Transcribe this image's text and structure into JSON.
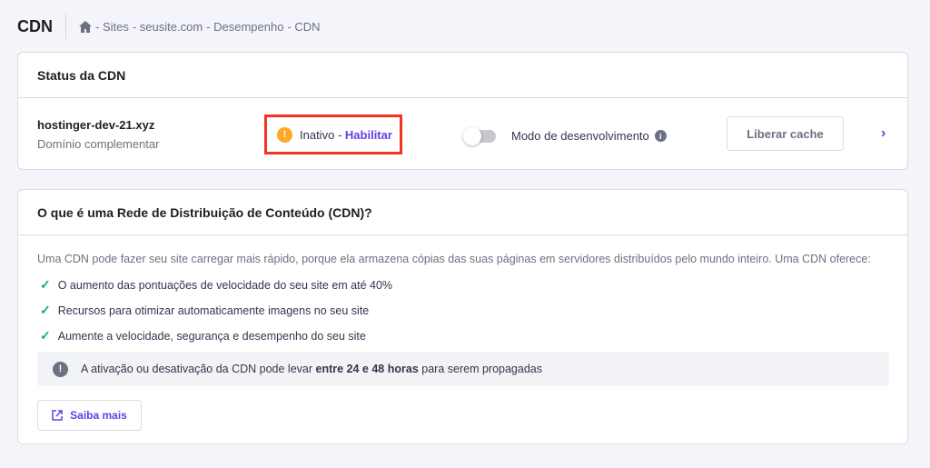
{
  "header": {
    "title": "CDN",
    "breadcrumb": [
      "- Sites",
      "- seusite.com",
      "- Desempenho",
      "- CDN"
    ]
  },
  "status_card": {
    "title": "Status da CDN",
    "domain": "hostinger-dev-21.xyz",
    "domain_type": "Domínio complementar",
    "status": "Inativo",
    "status_sep": "-",
    "enable_link": "Habilitar",
    "dev_mode_label": "Modo de desenvolvimento",
    "dev_mode_on": false,
    "clear_cache": "Liberar cache"
  },
  "info_card": {
    "title": "O que é uma Rede de Distribuição de Conteúdo (CDN)?",
    "description": "Uma CDN pode fazer seu site carregar mais rápido, porque ela armazena cópias das suas páginas em servidores distribuídos pelo mundo inteiro. Uma CDN oferece:",
    "benefits": [
      "O aumento das pontuações de velocidade do seu site em até 40%",
      "Recursos para otimizar automaticamente imagens no seu site",
      "Aumente a velocidade, segurança e desempenho do seu site"
    ],
    "note_pre": "A ativação ou desativação da CDN pode levar",
    "note_bold": "entre 24 e 48 horas",
    "note_post": "para serem propagadas",
    "learn_more": "Saiba mais"
  }
}
